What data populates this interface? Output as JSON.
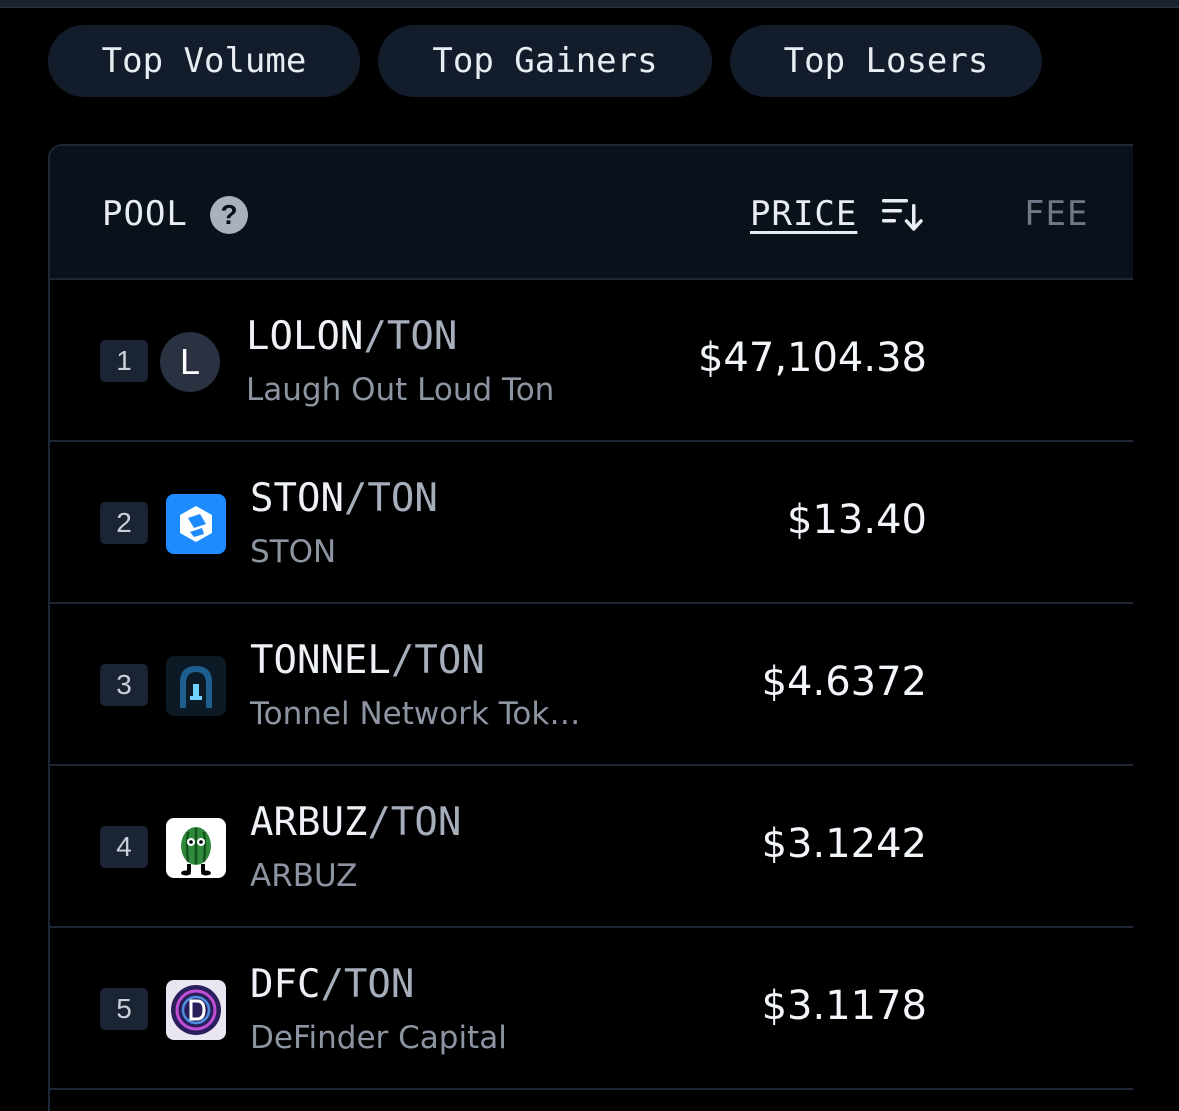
{
  "tabs": [
    {
      "label": "Top Volume"
    },
    {
      "label": "Top Gainers"
    },
    {
      "label": "Top Losers"
    }
  ],
  "table": {
    "headers": {
      "pool": "POOL",
      "price": "PRICE",
      "fee": "FEE"
    },
    "rows": [
      {
        "rank": "1",
        "base": "LOLON",
        "quote": "TON",
        "name": "Laugh Out Loud Ton",
        "price": "$47,104.38",
        "logo_letter": "L",
        "logo": "letter-l-icon"
      },
      {
        "rank": "2",
        "base": "STON",
        "quote": "TON",
        "name": "STON",
        "price": "$13.40",
        "logo": "ston-logo-icon"
      },
      {
        "rank": "3",
        "base": "TONNEL",
        "quote": "TON",
        "name": "Tonnel Network Tok…",
        "price": "$4.6372",
        "logo": "tonnel-logo-icon"
      },
      {
        "rank": "4",
        "base": "ARBUZ",
        "quote": "TON",
        "name": "ARBUZ",
        "price": "$3.1242",
        "logo": "arbuz-logo-icon"
      },
      {
        "rank": "5",
        "base": "DFC",
        "quote": "TON",
        "name": "DeFinder Capital",
        "price": "$3.1178",
        "logo": "dfc-logo-icon"
      }
    ]
  },
  "colors": {
    "background": "#000000",
    "chip": "#131c2a",
    "header": "#0b111a",
    "ston_blue": "#1e8cff"
  }
}
